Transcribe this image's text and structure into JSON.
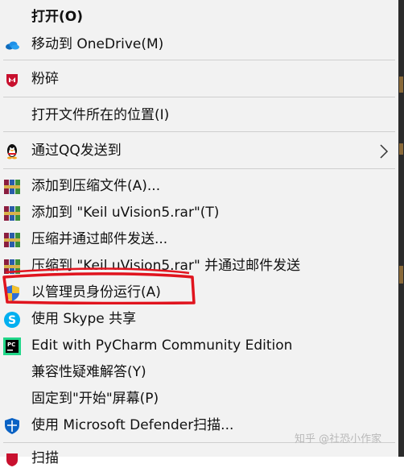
{
  "menu": {
    "items": [
      {
        "label": "打开(O)",
        "icon": "none",
        "bold": true
      },
      {
        "label": "移动到 OneDrive(M)",
        "icon": "onedrive-cloud-icon"
      },
      {
        "label": "粉碎",
        "icon": "mcafee-shield-icon"
      },
      {
        "label": "打开文件所在的位置(I)",
        "icon": "none"
      },
      {
        "label": "通过QQ发送到",
        "icon": "qq-penguin-icon",
        "submenu": true
      },
      {
        "label": "添加到压缩文件(A)...",
        "icon": "winrar-books-icon"
      },
      {
        "label": "添加到 \"Keil uVision5.rar\"(T)",
        "icon": "winrar-books-icon"
      },
      {
        "label": "压缩并通过邮件发送...",
        "icon": "winrar-books-icon"
      },
      {
        "label": "压缩到 \"Keil uVision5.rar\" 并通过邮件发送",
        "icon": "winrar-books-icon"
      },
      {
        "label": "以管理员身份运行(A)",
        "icon": "uac-shield-icon"
      },
      {
        "label": "使用 Skype 共享",
        "icon": "skype-icon"
      },
      {
        "label": "Edit with PyCharm Community Edition",
        "icon": "pycharm-icon"
      },
      {
        "label": "兼容性疑难解答(Y)",
        "icon": "none"
      },
      {
        "label": "固定到\"开始\"屏幕(P)",
        "icon": "none"
      },
      {
        "label": "使用 Microsoft Defender扫描...",
        "icon": "defender-shield-icon"
      },
      {
        "label": "扫描",
        "icon": "mcafee-shield-icon",
        "partially_visible": true
      }
    ]
  },
  "highlight": {
    "target": "以管理员身份运行(A)",
    "color": "#e0141e"
  },
  "watermark": {
    "text": "知乎 @社恐小作家"
  },
  "colors": {
    "menu_background": "#f2f2f2",
    "separator": "#cfcfcf",
    "text": "#111111",
    "annotation_red": "#e0141e"
  }
}
